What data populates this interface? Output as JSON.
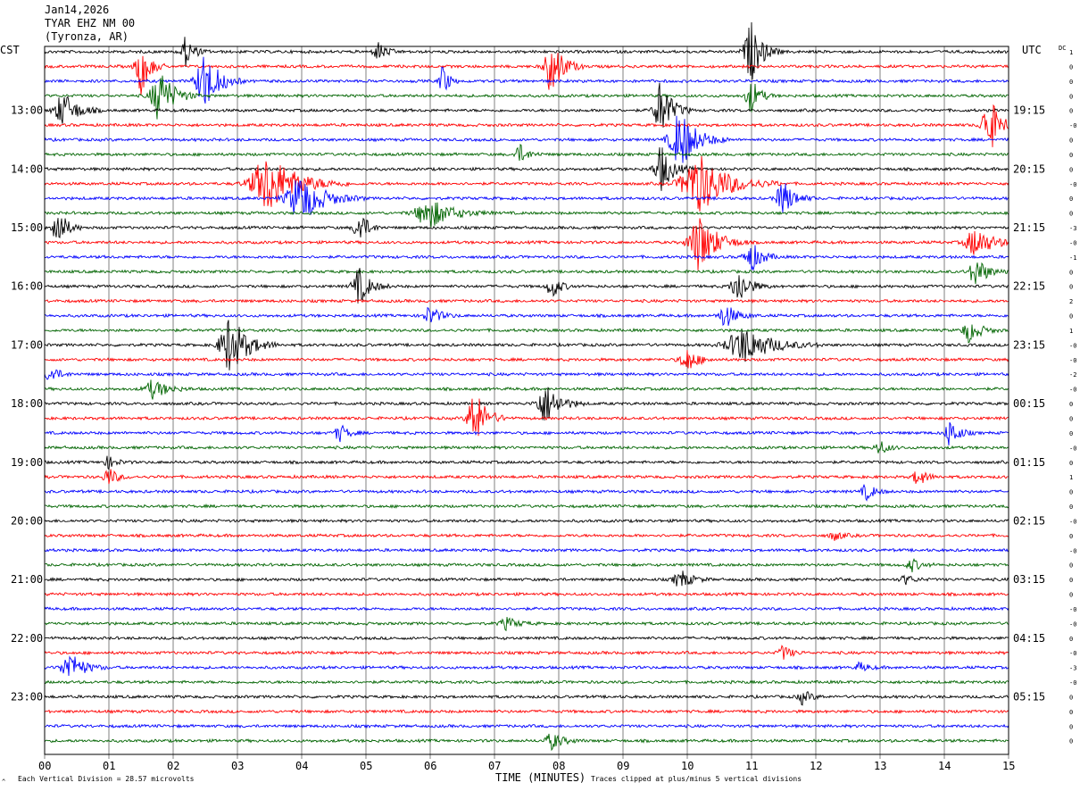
{
  "header": {
    "date": "Jan14,2026",
    "station": "TYAR EHZ NM 00",
    "location": "(Tyronza, AR)"
  },
  "left_axis_title": "CST",
  "right_axis_title": "UTC",
  "dc_title": "DC",
  "xlabel": "TIME (MINUTES)",
  "footer_left": "Each Vertical Division =   28.57 microvolts",
  "footer_right": "Traces clipped at plus/minus 5 vertical divisions",
  "corner_mark": "^",
  "colors": {
    "trace_cycle": [
      "#000000",
      "#ff0000",
      "#0000ff",
      "#006400"
    ],
    "grid": "#808080",
    "frame": "#000000"
  },
  "chart_data": {
    "type": "line",
    "x_range_minutes": [
      0,
      15
    ],
    "x_ticks": [
      "00",
      "01",
      "02",
      "03",
      "04",
      "05",
      "06",
      "07",
      "08",
      "09",
      "10",
      "11",
      "12",
      "13",
      "14",
      "15"
    ],
    "trace_count": 48,
    "trace_interval_minutes": 15,
    "start_time_cst": "12:30",
    "left_time_labels": [
      {
        "trace": 4,
        "label": "13:00"
      },
      {
        "trace": 8,
        "label": "14:00"
      },
      {
        "trace": 12,
        "label": "15:00"
      },
      {
        "trace": 16,
        "label": "16:00"
      },
      {
        "trace": 20,
        "label": "17:00"
      },
      {
        "trace": 24,
        "label": "18:00"
      },
      {
        "trace": 28,
        "label": "19:00"
      },
      {
        "trace": 32,
        "label": "20:00"
      },
      {
        "trace": 36,
        "label": "21:00"
      },
      {
        "trace": 40,
        "label": "22:00"
      },
      {
        "trace": 44,
        "label": "23:00"
      }
    ],
    "right_time_labels": [
      {
        "trace": 4,
        "label": "19:15"
      },
      {
        "trace": 8,
        "label": "20:15"
      },
      {
        "trace": 12,
        "label": "21:15"
      },
      {
        "trace": 16,
        "label": "22:15"
      },
      {
        "trace": 20,
        "label": "23:15"
      },
      {
        "trace": 24,
        "label": "00:15"
      },
      {
        "trace": 28,
        "label": "01:15"
      },
      {
        "trace": 32,
        "label": "02:15"
      },
      {
        "trace": 36,
        "label": "03:15"
      },
      {
        "trace": 40,
        "label": "04:15"
      },
      {
        "trace": 44,
        "label": "05:15"
      }
    ],
    "dc_offsets": [
      "1",
      "0",
      "0",
      "0",
      "0",
      "-0",
      "0",
      "0",
      "0",
      "-0",
      "0",
      "0",
      "-3",
      "-0",
      "-1",
      "0",
      "0",
      "2",
      "0",
      "1",
      "-0",
      "-0",
      "-2",
      "-0",
      "0",
      "0",
      "0",
      "-0",
      "0",
      "1",
      "0",
      "0",
      "-0",
      "0",
      "-0",
      "0",
      "0",
      "0",
      "-0",
      "-0",
      "0",
      "-0",
      "-3",
      "-0",
      "0",
      "0",
      "0",
      "0"
    ],
    "bursts": [
      {
        "trace": 0,
        "minute": 2.2,
        "amplitude": 2.5,
        "duration_min": 0.3
      },
      {
        "trace": 0,
        "minute": 5.2,
        "amplitude": 1.6,
        "duration_min": 0.3
      },
      {
        "trace": 0,
        "minute": 11.0,
        "amplitude": 5,
        "duration_min": 0.4
      },
      {
        "trace": 1,
        "minute": 1.5,
        "amplitude": 5,
        "duration_min": 0.3
      },
      {
        "trace": 1,
        "minute": 7.9,
        "amplitude": 5,
        "duration_min": 0.4
      },
      {
        "trace": 2,
        "minute": 2.5,
        "amplitude": 5,
        "duration_min": 0.5
      },
      {
        "trace": 2,
        "minute": 6.2,
        "amplitude": 3,
        "duration_min": 0.2
      },
      {
        "trace": 3,
        "minute": 1.8,
        "amplitude": 4.5,
        "duration_min": 0.5
      },
      {
        "trace": 3,
        "minute": 11.0,
        "amplitude": 3,
        "duration_min": 0.3
      },
      {
        "trace": 4,
        "minute": 0.3,
        "amplitude": 3,
        "duration_min": 0.5
      },
      {
        "trace": 4,
        "minute": 9.6,
        "amplitude": 5,
        "duration_min": 0.4
      },
      {
        "trace": 5,
        "minute": 14.7,
        "amplitude": 5,
        "duration_min": 0.4
      },
      {
        "trace": 6,
        "minute": 9.9,
        "amplitude": 5,
        "duration_min": 0.6
      },
      {
        "trace": 7,
        "minute": 7.4,
        "amplitude": 1.6,
        "duration_min": 0.3
      },
      {
        "trace": 8,
        "minute": 9.6,
        "amplitude": 4,
        "duration_min": 0.4
      },
      {
        "trace": 9,
        "minute": 3.5,
        "amplitude": 5,
        "duration_min": 1.0
      },
      {
        "trace": 9,
        "minute": 10.2,
        "amplitude": 5,
        "duration_min": 1.0
      },
      {
        "trace": 10,
        "minute": 4.0,
        "amplitude": 4,
        "duration_min": 0.8
      },
      {
        "trace": 10,
        "minute": 11.5,
        "amplitude": 3,
        "duration_min": 0.4
      },
      {
        "trace": 11,
        "minute": 6.0,
        "amplitude": 2.5,
        "duration_min": 0.8
      },
      {
        "trace": 12,
        "minute": 0.2,
        "amplitude": 4,
        "duration_min": 0.3
      },
      {
        "trace": 12,
        "minute": 4.9,
        "amplitude": 3,
        "duration_min": 0.3
      },
      {
        "trace": 13,
        "minute": 10.2,
        "amplitude": 5,
        "duration_min": 0.6
      },
      {
        "trace": 13,
        "minute": 14.5,
        "amplitude": 2.5,
        "duration_min": 0.6
      },
      {
        "trace": 14,
        "minute": 11.0,
        "amplitude": 2.5,
        "duration_min": 0.4
      },
      {
        "trace": 15,
        "minute": 14.5,
        "amplitude": 2.5,
        "duration_min": 0.4
      },
      {
        "trace": 16,
        "minute": 4.9,
        "amplitude": 3,
        "duration_min": 0.4
      },
      {
        "trace": 16,
        "minute": 7.9,
        "amplitude": 2,
        "duration_min": 0.3
      },
      {
        "trace": 16,
        "minute": 10.8,
        "amplitude": 3,
        "duration_min": 0.4
      },
      {
        "trace": 18,
        "minute": 10.6,
        "amplitude": 2,
        "duration_min": 0.4
      },
      {
        "trace": 18,
        "minute": 6.0,
        "amplitude": 1.5,
        "duration_min": 0.4
      },
      {
        "trace": 19,
        "minute": 14.4,
        "amplitude": 2,
        "duration_min": 0.4
      },
      {
        "trace": 20,
        "minute": 2.9,
        "amplitude": 5,
        "duration_min": 0.6
      },
      {
        "trace": 20,
        "minute": 10.9,
        "amplitude": 3,
        "duration_min": 1.0
      },
      {
        "trace": 21,
        "minute": 10.0,
        "amplitude": 2,
        "duration_min": 0.4
      },
      {
        "trace": 22,
        "minute": 0.1,
        "amplitude": 1.5,
        "duration_min": 0.3
      },
      {
        "trace": 23,
        "minute": 1.7,
        "amplitude": 1.6,
        "duration_min": 0.5
      },
      {
        "trace": 24,
        "minute": 7.8,
        "amplitude": 3.5,
        "duration_min": 0.5
      },
      {
        "trace": 25,
        "minute": 6.7,
        "amplitude": 5,
        "duration_min": 0.4
      },
      {
        "trace": 26,
        "minute": 14.1,
        "amplitude": 2.5,
        "duration_min": 0.3
      },
      {
        "trace": 26,
        "minute": 4.6,
        "amplitude": 1.5,
        "duration_min": 0.3
      },
      {
        "trace": 27,
        "minute": 13.0,
        "amplitude": 1.2,
        "duration_min": 0.3
      },
      {
        "trace": 28,
        "minute": 1.0,
        "amplitude": 1,
        "duration_min": 0.3
      },
      {
        "trace": 29,
        "minute": 1.0,
        "amplitude": 1.6,
        "duration_min": 0.3
      },
      {
        "trace": 29,
        "minute": 13.6,
        "amplitude": 1.5,
        "duration_min": 0.3
      },
      {
        "trace": 30,
        "minute": 12.8,
        "amplitude": 1.4,
        "duration_min": 0.3
      },
      {
        "trace": 33,
        "minute": 12.3,
        "amplitude": 0.8,
        "duration_min": 0.3
      },
      {
        "trace": 35,
        "minute": 13.5,
        "amplitude": 1.1,
        "duration_min": 0.3
      },
      {
        "trace": 36,
        "minute": 9.9,
        "amplitude": 1.6,
        "duration_min": 0.4
      },
      {
        "trace": 36,
        "minute": 13.4,
        "amplitude": 0.8,
        "duration_min": 0.3
      },
      {
        "trace": 39,
        "minute": 7.2,
        "amplitude": 1,
        "duration_min": 0.4
      },
      {
        "trace": 41,
        "minute": 11.5,
        "amplitude": 1.2,
        "duration_min": 0.3
      },
      {
        "trace": 42,
        "minute": 0.4,
        "amplitude": 2.5,
        "duration_min": 0.5
      },
      {
        "trace": 42,
        "minute": 12.7,
        "amplitude": 0.8,
        "duration_min": 0.3
      },
      {
        "trace": 44,
        "minute": 11.8,
        "amplitude": 1.2,
        "duration_min": 0.3
      },
      {
        "trace": 47,
        "minute": 7.9,
        "amplitude": 1.4,
        "duration_min": 0.4
      }
    ]
  }
}
